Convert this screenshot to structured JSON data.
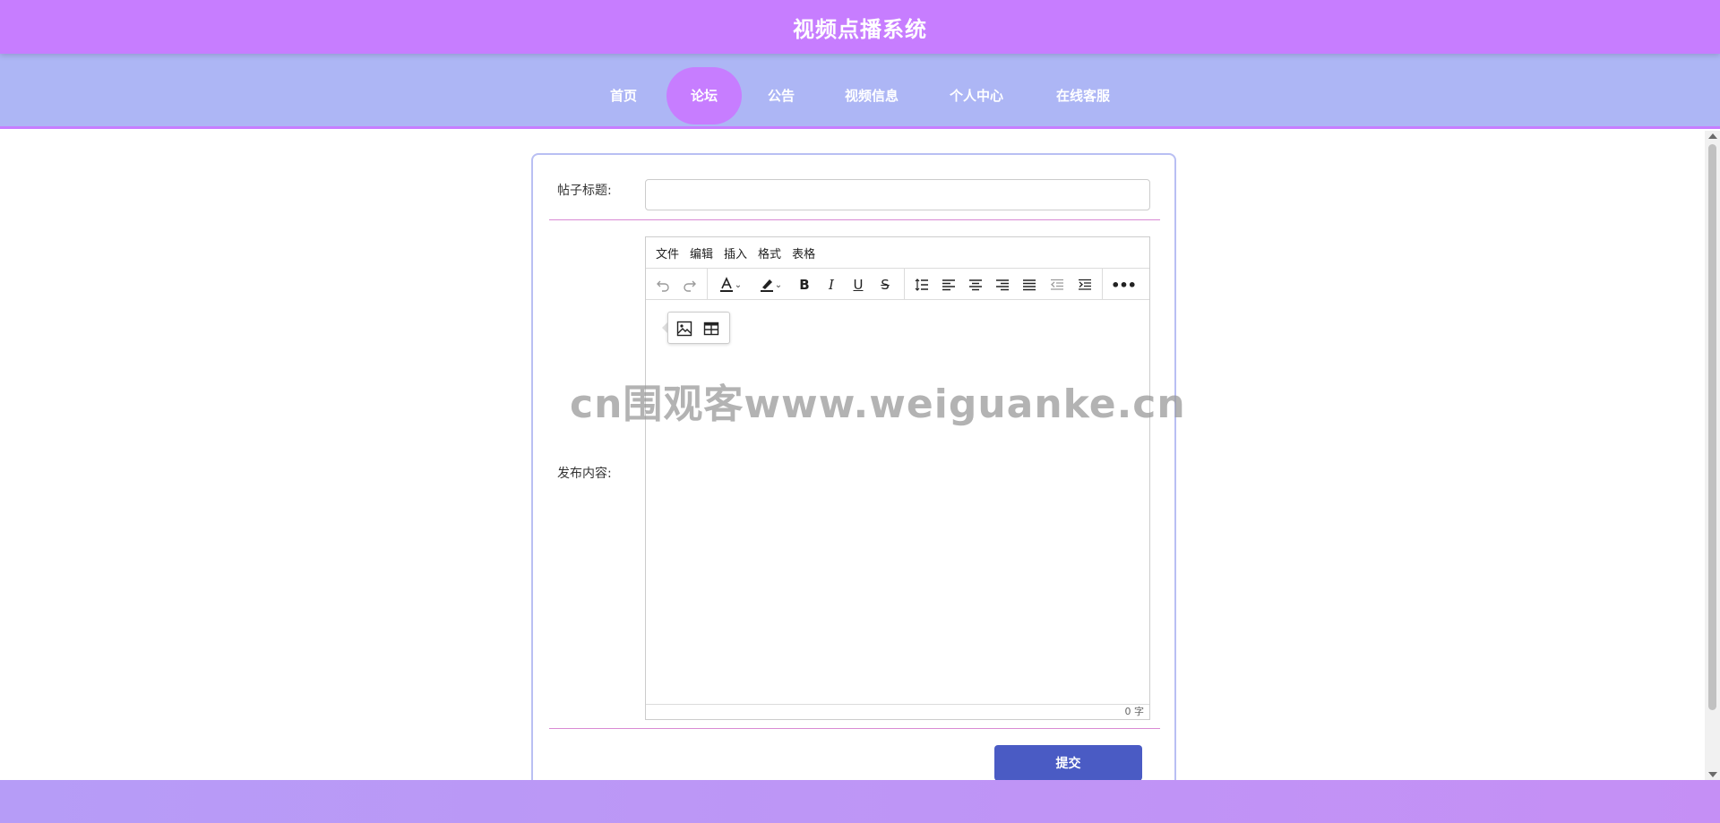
{
  "app": {
    "title": "视频点播系统"
  },
  "nav": {
    "items": [
      {
        "label": "首页",
        "active": false
      },
      {
        "label": "论坛",
        "active": true
      },
      {
        "label": "公告",
        "active": false
      },
      {
        "label": "视频信息",
        "active": false
      },
      {
        "label": "个人中心",
        "active": false
      },
      {
        "label": "在线客服",
        "active": false
      }
    ]
  },
  "form": {
    "title_label": "帖子标题:",
    "title_value": "",
    "content_label": "发布内容:",
    "submit_label": "提交"
  },
  "editor": {
    "menus": [
      "文件",
      "编辑",
      "插入",
      "格式",
      "表格"
    ],
    "toolbar_icons": [
      "undo-icon",
      "redo-icon",
      "text-color-icon",
      "highlight-color-icon",
      "bold-icon",
      "italic-icon",
      "underline-icon",
      "strikethrough-icon",
      "line-height-icon",
      "align-left-icon",
      "align-center-icon",
      "align-right-icon",
      "align-justify-icon",
      "outdent-icon",
      "indent-icon",
      "more-icon"
    ],
    "quick_insert_icons": [
      "image-icon",
      "table-icon"
    ],
    "word_count": "0 字"
  },
  "watermark": {
    "text": "cn围观客www.weiguanke.cn"
  },
  "colors": {
    "header": "#c77dff",
    "nav": "#adb6f5",
    "nav_active": "#c77dff",
    "submit": "#4a5bc4",
    "divider": "#d98ad4"
  }
}
